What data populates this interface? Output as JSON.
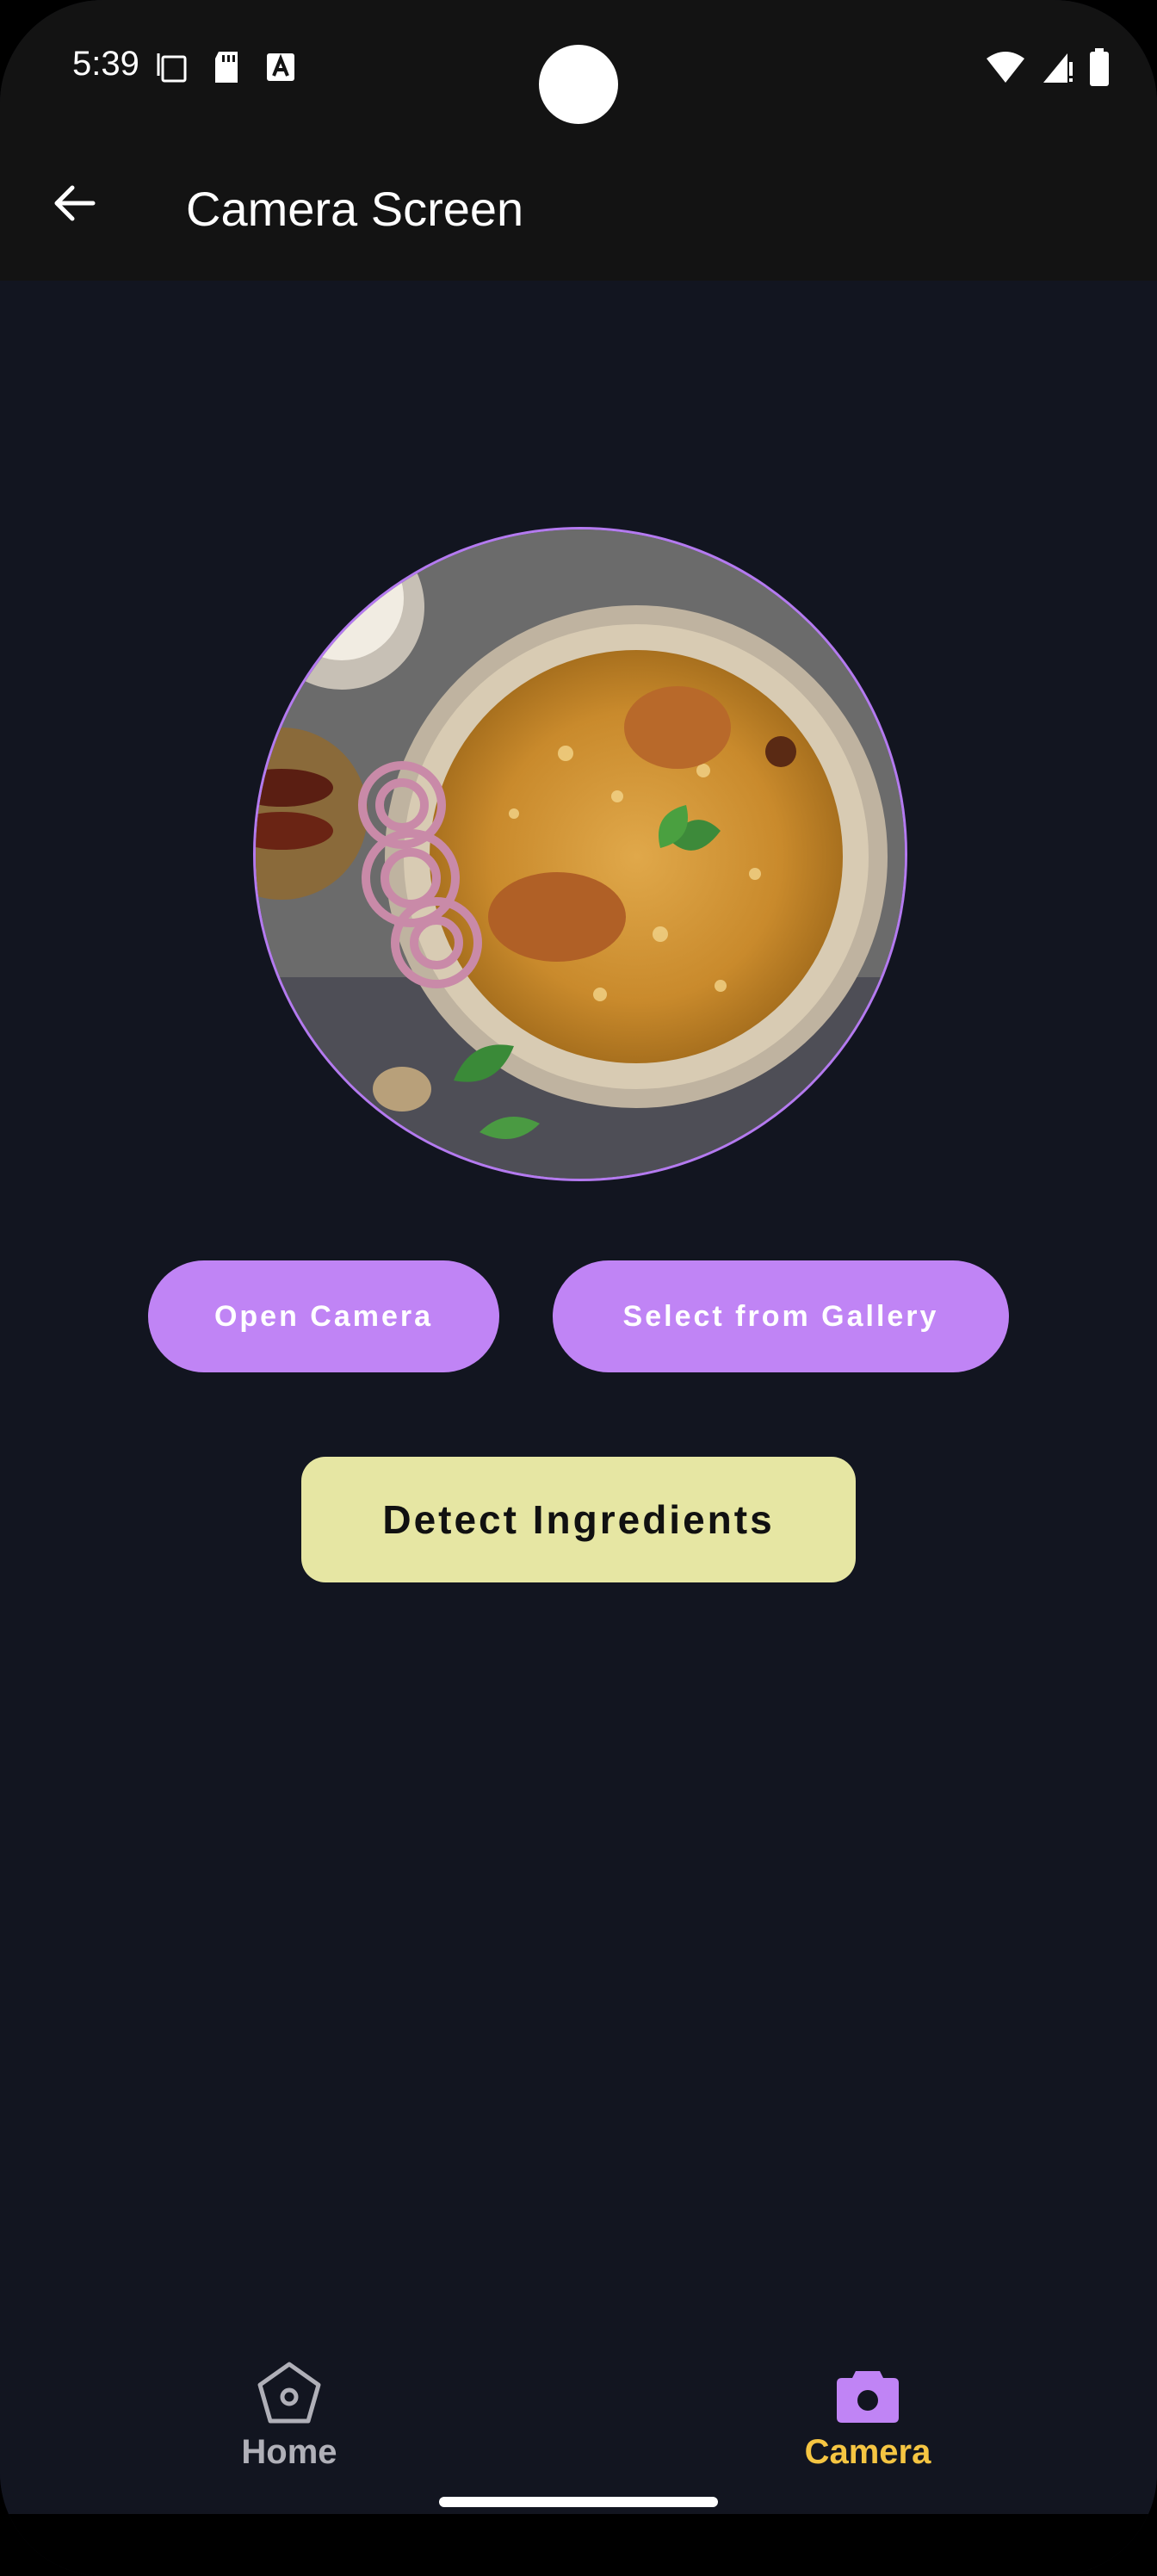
{
  "status_bar": {
    "time": "5:39"
  },
  "app_bar": {
    "title": "Camera Screen"
  },
  "buttons": {
    "open_camera": "Open Camera",
    "select_gallery": "Select from Gallery",
    "detect": "Detect Ingredients"
  },
  "bottom_nav": {
    "items": [
      {
        "label": "Home",
        "icon": "home-pentagon-icon",
        "selected": false
      },
      {
        "label": "Camera",
        "icon": "camera-icon",
        "selected": true
      }
    ]
  },
  "colors": {
    "background": "#121520",
    "primary_button": "#c084f5",
    "detect_button": "#e6e6a3",
    "selected_nav": "#f5c542",
    "unselected_nav": "#b0b0b8"
  }
}
